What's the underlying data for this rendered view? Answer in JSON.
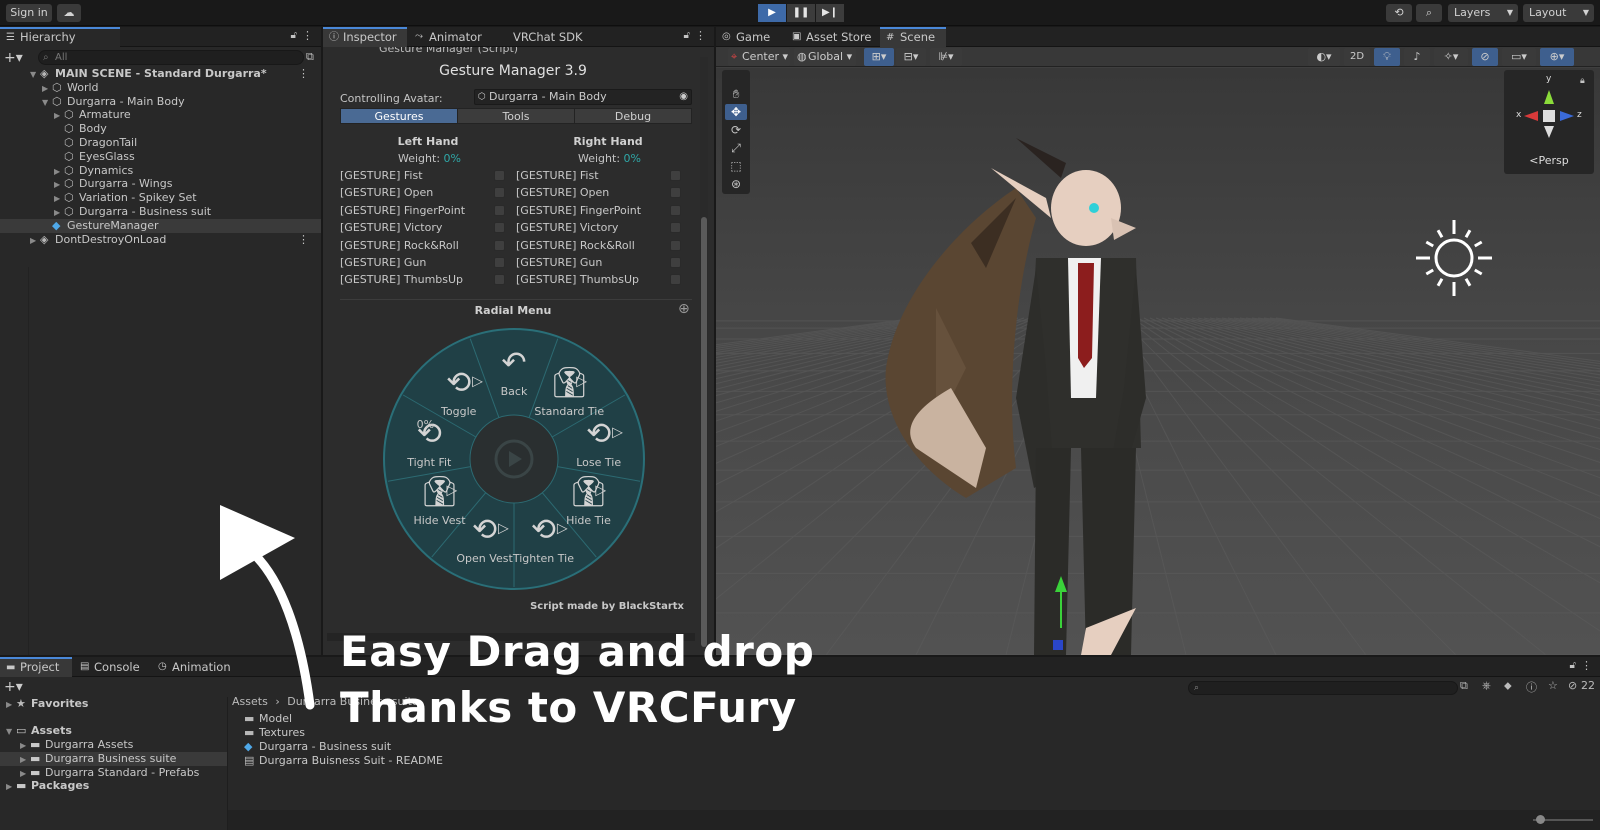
{
  "toolbar": {
    "sign_in": "Sign in",
    "cloud_icon": "cloud-icon",
    "layers": "Layers",
    "layout": "Layout",
    "play_state": "playing"
  },
  "hierarchy": {
    "tab": "Hierarchy",
    "search_placeholder": "All",
    "items": [
      {
        "label": "MAIN SCENE - Standard Durgarra*",
        "depth": 0,
        "icon": "unity-scene-icon",
        "bold": true
      },
      {
        "label": "World",
        "depth": 1,
        "icon": "gameobject-icon"
      },
      {
        "label": "Durgarra - Main Body",
        "depth": 1,
        "icon": "gameobject-icon"
      },
      {
        "label": "Armature",
        "depth": 2,
        "icon": "gameobject-icon"
      },
      {
        "label": "Body",
        "depth": 2,
        "icon": "gameobject-icon"
      },
      {
        "label": "DragonTail",
        "depth": 2,
        "icon": "gameobject-icon"
      },
      {
        "label": "EyesGlass",
        "depth": 2,
        "icon": "gameobject-icon"
      },
      {
        "label": "Dynamics",
        "depth": 2,
        "icon": "gameobject-icon"
      },
      {
        "label": "Durgarra - Wings",
        "depth": 2,
        "icon": "gameobject-icon"
      },
      {
        "label": "Variation - Spikey Set",
        "depth": 2,
        "icon": "gameobject-icon"
      },
      {
        "label": "Durgarra - Business suit",
        "depth": 2,
        "icon": "gameobject-icon"
      },
      {
        "label": "GestureManager",
        "depth": 1,
        "icon": "prefab-icon",
        "selected": true
      },
      {
        "label": "DontDestroyOnLoad",
        "depth": 0,
        "icon": "unity-scene-icon"
      }
    ]
  },
  "inspector": {
    "tabs": [
      "Inspector",
      "Animator",
      "VRChat SDK"
    ],
    "component": "Gesture Manager (Script)",
    "title": "Gesture Manager 3.9",
    "controlling_label": "Controlling Avatar:",
    "controlling_value": "Durgarra - Main Body",
    "mode_tabs": [
      "Gestures",
      "Tools",
      "Debug"
    ],
    "left_hand": "Left Hand",
    "right_hand": "Right Hand",
    "weight_label": "Weight:",
    "weight_value": "0%",
    "gestures": [
      "[GESTURE] Fist",
      "[GESTURE] Open",
      "[GESTURE] FingerPoint",
      "[GESTURE] Victory",
      "[GESTURE] Rock&Roll",
      "[GESTURE] Gun",
      "[GESTURE] ThumbsUp"
    ],
    "radial_title": "Radial Menu",
    "radial_items": [
      "Back",
      "Standard Tie",
      "Lose Tie",
      "Hide Tie",
      "Tighten Tie",
      "Open Vest",
      "Hide Vest",
      "Tight Fit",
      "Toggle"
    ],
    "tight_fit_value": "0%",
    "credit": "Script made by BlackStartx"
  },
  "scene": {
    "tabs": [
      "Game",
      "Asset Store",
      "Scene"
    ],
    "pivot": "Center",
    "space": "Global",
    "mode_2d": "2D",
    "persp": "Persp",
    "gizmo_axes": {
      "x": "x",
      "y": "y",
      "z": "z"
    }
  },
  "project": {
    "tabs": [
      "Project",
      "Console",
      "Animation"
    ],
    "tree": [
      {
        "label": "Favorites",
        "depth": 0,
        "icon": "star-icon",
        "bold": true
      },
      {
        "label": "Assets",
        "depth": 0,
        "icon": "folder-open-icon",
        "bold": true
      },
      {
        "label": "Durgarra Assets",
        "depth": 1,
        "icon": "folder-icon"
      },
      {
        "label": "Durgarra Business suite",
        "depth": 1,
        "icon": "folder-icon",
        "selected": true
      },
      {
        "label": "Durgarra Standard - Prefabs",
        "depth": 1,
        "icon": "folder-icon"
      },
      {
        "label": "Packages",
        "depth": 0,
        "icon": "folder-icon",
        "bold": true
      }
    ],
    "breadcrumb": [
      "Assets",
      "Durgarra Business suite"
    ],
    "files": [
      {
        "label": "Model",
        "icon": "folder-icon"
      },
      {
        "label": "Textures",
        "icon": "folder-icon"
      },
      {
        "label": "Durgarra - Business suit",
        "icon": "prefab-icon"
      },
      {
        "label": "Durgarra Buisness Suit - README",
        "icon": "document-icon"
      }
    ],
    "hidden_count": "22"
  },
  "overlay": {
    "line1": "Easy Drag and drop",
    "line2": "Thanks to VRCFury"
  }
}
